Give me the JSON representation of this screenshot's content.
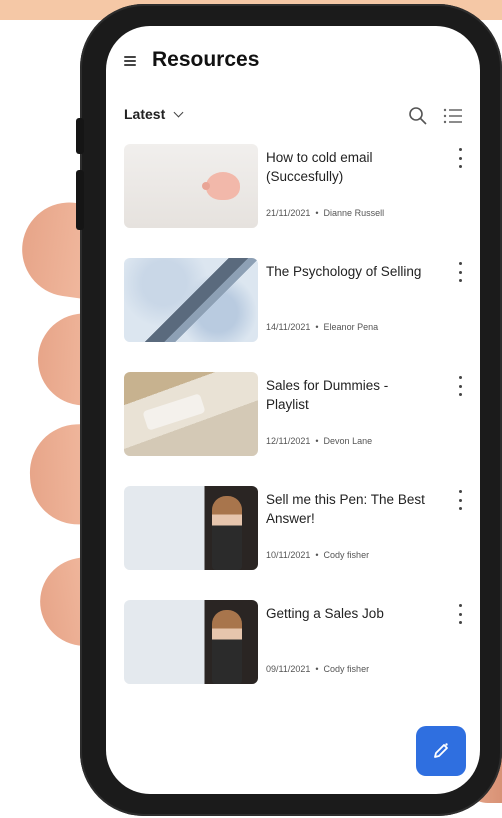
{
  "header": {
    "title": "Resources"
  },
  "filter": {
    "selected": "Latest"
  },
  "items": [
    {
      "title": "How to cold email (Succesfully)",
      "date": "21/11/2021",
      "author": "Dianne Russell"
    },
    {
      "title": "The Psychology of Selling",
      "date": "14/11/2021",
      "author": "Eleanor Pena"
    },
    {
      "title": "Sales for Dummies - Playlist",
      "date": "12/11/2021",
      "author": "Devon Lane"
    },
    {
      "title": "Sell me this Pen: The Best Answer!",
      "date": "10/11/2021",
      "author": "Cody fisher"
    },
    {
      "title": "Getting a Sales Job",
      "date": "09/11/2021",
      "author": "Cody fisher"
    }
  ],
  "icons": {
    "menu": "hamburger-icon",
    "filter_toggle": "chevron-down-icon",
    "search": "search-icon",
    "list": "list-icon",
    "more": "more-vertical-icon",
    "fab": "edit-icon"
  },
  "colors": {
    "accent": "#2f6fe0",
    "title": "#111111",
    "meta": "#555555"
  }
}
